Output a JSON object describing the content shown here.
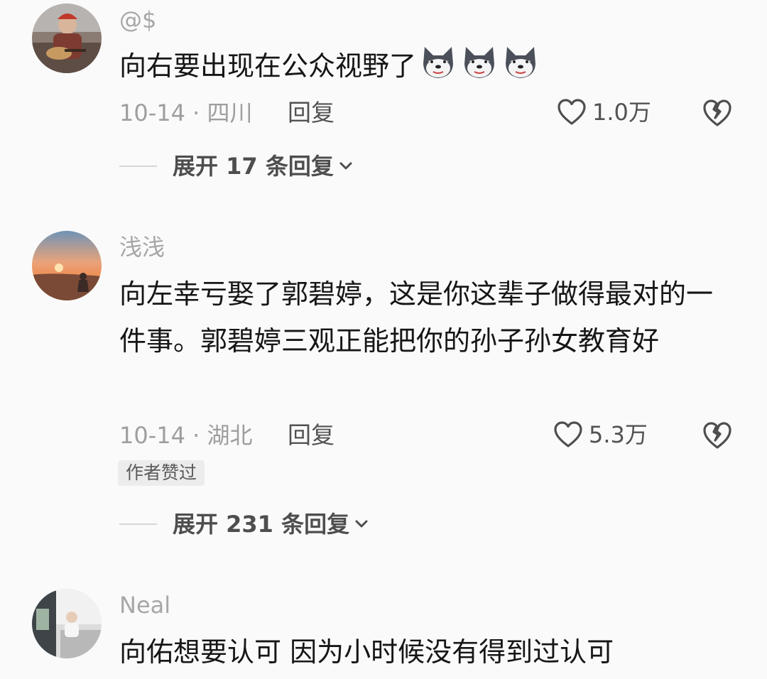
{
  "comments": [
    {
      "username": "@$",
      "text": "向右要出现在公众视野了",
      "emojis": [
        "husky-emoji",
        "husky-emoji",
        "husky-emoji"
      ],
      "date": "10-14",
      "region": "四川",
      "meta": "10-14 · 四川",
      "reply_label": "回复",
      "likes": "1.0万",
      "expand_label": "展开 17 条回复"
    },
    {
      "username": "浅浅",
      "text": "向左幸亏娶了郭碧婷，这是你这辈子做得最对的一件事。郭碧婷三观正能把你的孙子孙女教育好",
      "date": "10-14",
      "region": "湖北",
      "meta": "10-14 · 湖北",
      "reply_label": "回复",
      "likes": "5.3万",
      "badge": "作者赞过",
      "expand_label": "展开 231 条回复"
    },
    {
      "username": "Neal",
      "text": "向佑想要认可 因为小时候没有得到过认可"
    }
  ],
  "icons": {
    "like": "heart-outline-icon",
    "dislike": "broken-heart-icon",
    "expand": "chevron-down-icon"
  },
  "colors": {
    "background": "#fafafa",
    "username": "#a7a7a7",
    "text": "#161616",
    "meta": "#9e9e9e",
    "badge_bg": "#ececec"
  }
}
